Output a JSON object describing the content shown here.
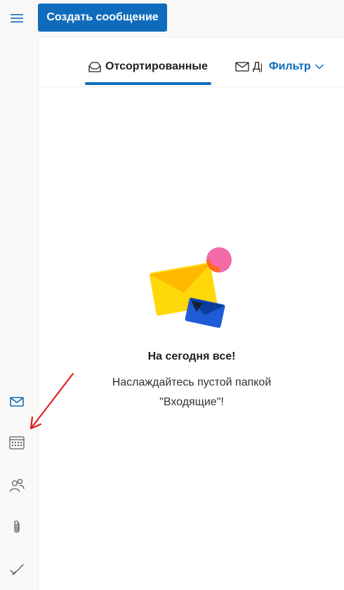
{
  "header": {
    "menu_icon": "hamburger-icon",
    "compose_label": "Создать сообщение"
  },
  "left_rail": {
    "items": [
      {
        "icon": "mail-icon",
        "active": true
      },
      {
        "icon": "calendar-icon",
        "active": false
      },
      {
        "icon": "people-icon",
        "active": false
      },
      {
        "icon": "paperclip-icon",
        "active": false
      },
      {
        "icon": "checkmark-icon",
        "active": false
      }
    ]
  },
  "tabs": {
    "focused": {
      "label": "Отсортированные",
      "icon": "inbox-icon",
      "selected": true
    },
    "other": {
      "label": "Другие",
      "icon": "mail-icon",
      "selected": false
    }
  },
  "filter": {
    "label": "Фильтр",
    "icon": "chevron-down-icon"
  },
  "empty_state": {
    "title": "На сегодня все!",
    "subtitle": "Наслаждайтесь пустой папкой \"Входящие\"!"
  },
  "colors": {
    "accent": "#0f6cbd",
    "annotation_arrow": "#e02020",
    "envelope_yellow": "#ffd80a",
    "envelope_blue": "#1f5bd6",
    "dot_pink": "#f26aa7"
  }
}
